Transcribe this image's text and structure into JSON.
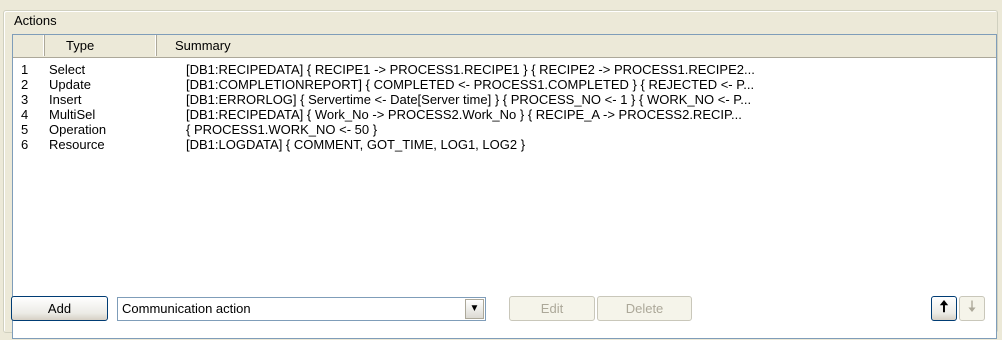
{
  "group": {
    "title": "Actions"
  },
  "list": {
    "columns": {
      "num": "",
      "type": "Type",
      "summary": "Summary"
    },
    "rows": [
      {
        "num": "1",
        "type": "Select",
        "summary": "[DB1:RECIPEDATA] { RECIPE1 -> PROCESS1.RECIPE1 } { RECIPE2 -> PROCESS1.RECIPE2..."
      },
      {
        "num": "2",
        "type": "Update",
        "summary": "[DB1:COMPLETIONREPORT] { COMPLETED <- PROCESS1.COMPLETED } { REJECTED <- P..."
      },
      {
        "num": "3",
        "type": "Insert",
        "summary": "[DB1:ERRORLOG] { Servertime <- Date[Server time] } { PROCESS_NO <- 1 } { WORK_NO <- P..."
      },
      {
        "num": "4",
        "type": "MultiSel",
        "summary": "[DB1:RECIPEDATA] { Work_No -> PROCESS2.Work_No } { RECIPE_A -> PROCESS2.RECIP..."
      },
      {
        "num": "5",
        "type": "Operation",
        "summary": "{ PROCESS1.WORK_NO <- 50 }"
      },
      {
        "num": "6",
        "type": "Resource",
        "summary": "[DB1:LOGDATA] { COMMENT,  GOT_TIME,  LOG1,  LOG2 }"
      }
    ]
  },
  "toolbar": {
    "add_label": "Add",
    "combo_value": "Communication action",
    "edit_label": "Edit",
    "delete_label": "Delete",
    "up_glyph": "🠅",
    "down_glyph": "🠇"
  }
}
